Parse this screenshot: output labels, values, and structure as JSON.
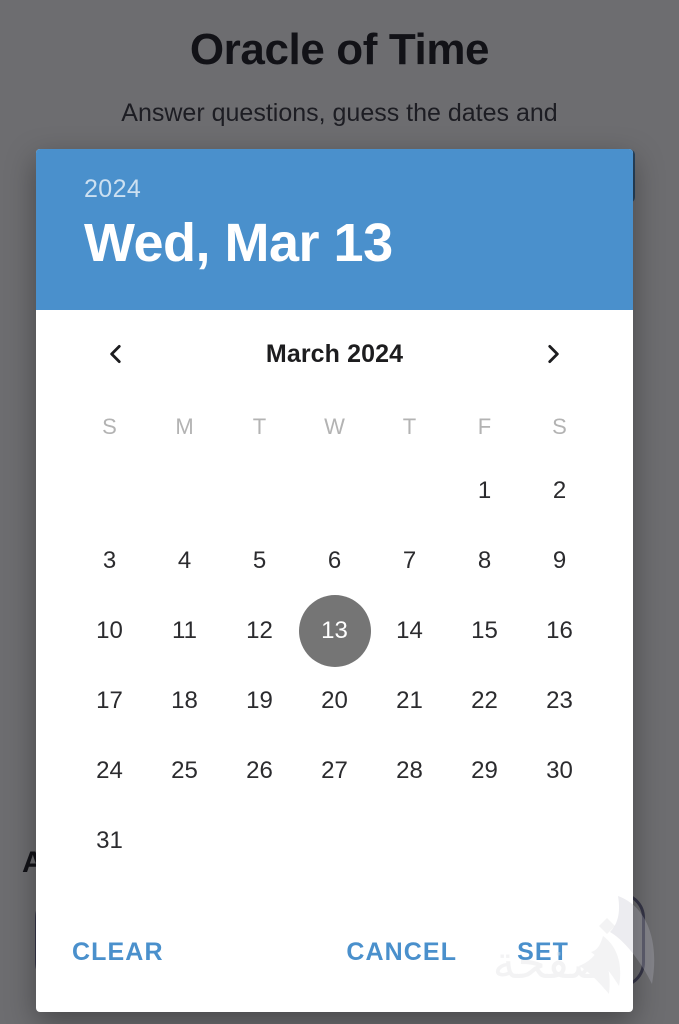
{
  "background": {
    "title": "Oracle of Time",
    "subtitle": "Answer questions, guess the dates and",
    "field_label": "A"
  },
  "dialog": {
    "header": {
      "year": "2024",
      "selected_date": "Wed, Mar 13"
    },
    "month_nav": {
      "prev_icon": "chevron-left-icon",
      "label": "March 2024",
      "next_icon": "chevron-right-icon"
    },
    "weekdays": [
      "S",
      "M",
      "T",
      "W",
      "T",
      "F",
      "S"
    ],
    "days": [
      "",
      "",
      "",
      "",
      "",
      "1",
      "2",
      "3",
      "4",
      "5",
      "6",
      "7",
      "8",
      "9",
      "10",
      "11",
      "12",
      "13",
      "14",
      "15",
      "16",
      "17",
      "18",
      "19",
      "20",
      "21",
      "22",
      "23",
      "24",
      "25",
      "26",
      "27",
      "28",
      "29",
      "30",
      "31",
      "",
      "",
      "",
      "",
      "",
      ""
    ],
    "selected_day": "13",
    "actions": {
      "clear": "CLEAR",
      "cancel": "CANCEL",
      "set": "SET"
    }
  },
  "watermark": {
    "text": "صفحة"
  },
  "colors": {
    "header_blue": "#4a90cc",
    "accent_blue": "#4a90cc",
    "selected_day_bg": "#757575",
    "scrim": "rgba(20,20,24,0.62)",
    "day_text": "#2b2b2e",
    "weekday_text": "#b3b3b3"
  }
}
